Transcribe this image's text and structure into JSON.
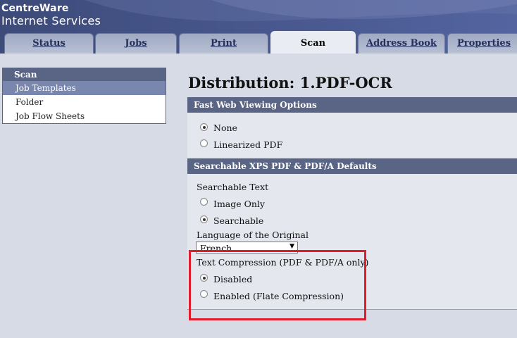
{
  "brand": {
    "line1": "CentreWare",
    "line2": "Internet Services"
  },
  "tabs": [
    {
      "label": "Status",
      "active": false
    },
    {
      "label": "Jobs",
      "active": false
    },
    {
      "label": "Print",
      "active": false
    },
    {
      "label": "Scan",
      "active": true
    },
    {
      "label": "Address Book",
      "active": false
    },
    {
      "label": "Properties",
      "active": false
    }
  ],
  "sidebar": {
    "heading": "Scan",
    "items": [
      "Job Templates",
      "Folder",
      "Job Flow Sheets"
    ],
    "selected": "Job Templates"
  },
  "page": {
    "title": "Distribution: 1.PDF-OCR"
  },
  "fast_web": {
    "heading": "Fast Web Viewing Options",
    "options": [
      "None",
      "Linearized PDF"
    ],
    "selected": "None"
  },
  "searchable": {
    "heading": "Searchable XPS PDF & PDF/A Defaults",
    "text_label": "Searchable Text",
    "options": [
      "Image Only",
      "Searchable"
    ],
    "selected": "Searchable",
    "language_label": "Language of the Original",
    "language_value": "French"
  },
  "compression": {
    "label": "Text Compression (PDF & PDF/A only)",
    "options": [
      "Disabled",
      "Enabled (Flate Compression)"
    ],
    "selected": "Disabled"
  },
  "colors": {
    "header": "#4a5990",
    "section": "#5a6484",
    "highlight": "#e21d2b"
  }
}
